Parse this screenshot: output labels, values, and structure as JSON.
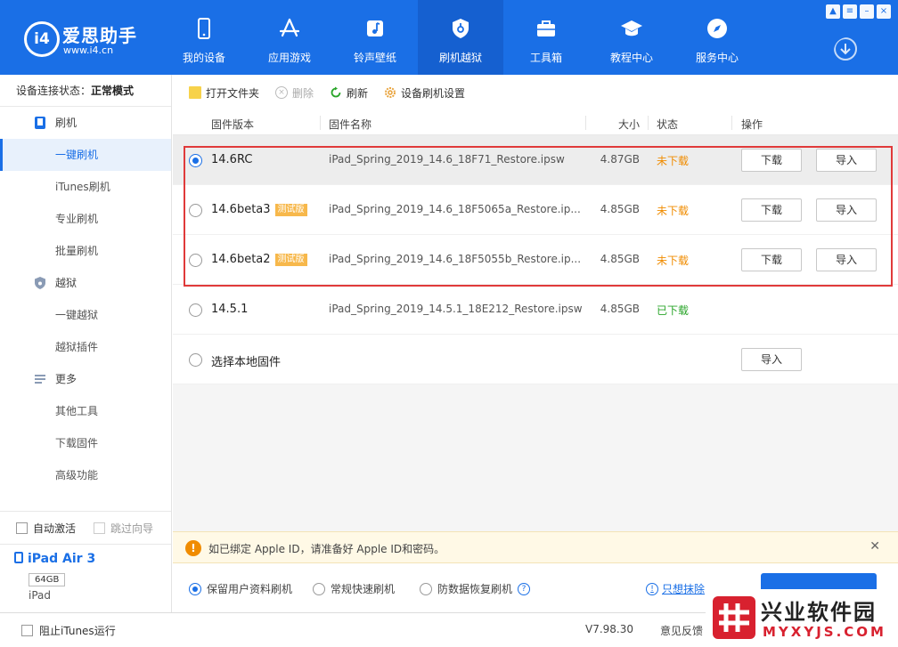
{
  "header": {
    "logo_title": "爱思助手",
    "logo_url": "www.i4.cn",
    "logo_mark": "i4",
    "nav": [
      {
        "label": "我的设备",
        "icon": "phone-icon"
      },
      {
        "label": "应用游戏",
        "icon": "app-store-icon"
      },
      {
        "label": "铃声壁纸",
        "icon": "music-note-icon"
      },
      {
        "label": "刷机越狱",
        "icon": "shield-icon",
        "active": true
      },
      {
        "label": "工具箱",
        "icon": "toolbox-icon"
      },
      {
        "label": "教程中心",
        "icon": "graduation-cap-icon"
      },
      {
        "label": "服务中心",
        "icon": "compass-icon"
      }
    ],
    "window_controls": [
      "shirt-icon",
      "menu-icon",
      "minimize-icon",
      "close-icon"
    ]
  },
  "sidebar": {
    "status_label": "设备连接状态：",
    "status_value": "正常模式",
    "groups": [
      {
        "label": "刷机",
        "icon": "phone-flash-icon",
        "items": [
          "一键刷机",
          "iTunes刷机",
          "专业刷机",
          "批量刷机"
        ]
      },
      {
        "label": "越狱",
        "icon": "jailbreak-shield-icon",
        "items": [
          "一键越狱",
          "越狱插件"
        ]
      },
      {
        "label": "更多",
        "icon": "more-lines-icon",
        "items": [
          "其他工具",
          "下载固件",
          "高级功能"
        ]
      }
    ],
    "active_item": "一键刷机",
    "auto_activate": "自动激活",
    "skip_guide": "跳过向导",
    "device": {
      "name": "iPad Air 3",
      "capacity": "64GB",
      "type": "iPad"
    }
  },
  "toolbar": {
    "open_folder": "打开文件夹",
    "delete": "删除",
    "refresh": "刷新",
    "settings": "设备刷机设置"
  },
  "table": {
    "columns": {
      "version": "固件版本",
      "name": "固件名称",
      "size": "大小",
      "status": "状态",
      "action": "操作"
    },
    "rows": [
      {
        "version": "14.6RC",
        "tag": "",
        "name": "iPad_Spring_2019_14.6_18F71_Restore.ipsw",
        "size": "4.87GB",
        "status": "未下载",
        "downloaded": false,
        "selected": true,
        "download_label": "下载",
        "import_label": "导入"
      },
      {
        "version": "14.6beta3",
        "tag": "测试版",
        "name": "iPad_Spring_2019_14.6_18F5065a_Restore.ip...",
        "size": "4.85GB",
        "status": "未下载",
        "downloaded": false,
        "selected": false,
        "download_label": "下载",
        "import_label": "导入"
      },
      {
        "version": "14.6beta2",
        "tag": "测试版",
        "name": "iPad_Spring_2019_14.6_18F5055b_Restore.ip...",
        "size": "4.85GB",
        "status": "未下载",
        "downloaded": false,
        "selected": false,
        "download_label": "下载",
        "import_label": "导入"
      },
      {
        "version": "14.5.1",
        "tag": "",
        "name": "iPad_Spring_2019_14.5.1_18E212_Restore.ipsw",
        "size": "4.85GB",
        "status": "已下载",
        "downloaded": true,
        "selected": false
      }
    ],
    "local_label": "选择本地固件",
    "local_import": "导入"
  },
  "notice": {
    "text": "如已绑定 Apple ID，请准备好 Apple ID和密码。"
  },
  "options": {
    "keep_data": "保留用户资料刷机",
    "quick_flash": "常规快速刷机",
    "recovery_flash": "防数据恢复刷机",
    "erase_link": "只想抹除"
  },
  "statusbar": {
    "block_itunes": "阻止iTunes运行",
    "version": "V7.98.30",
    "feedback": "意见反馈"
  },
  "watermark": {
    "title": "兴业软件园",
    "url": "MYXYJS.COM"
  },
  "colors": {
    "brand": "#1a6fe6",
    "not_downloaded": "#f08c00",
    "downloaded": "#2aa52a",
    "highlight": "#e03a3a",
    "beta_tag": "#f7b84b"
  }
}
